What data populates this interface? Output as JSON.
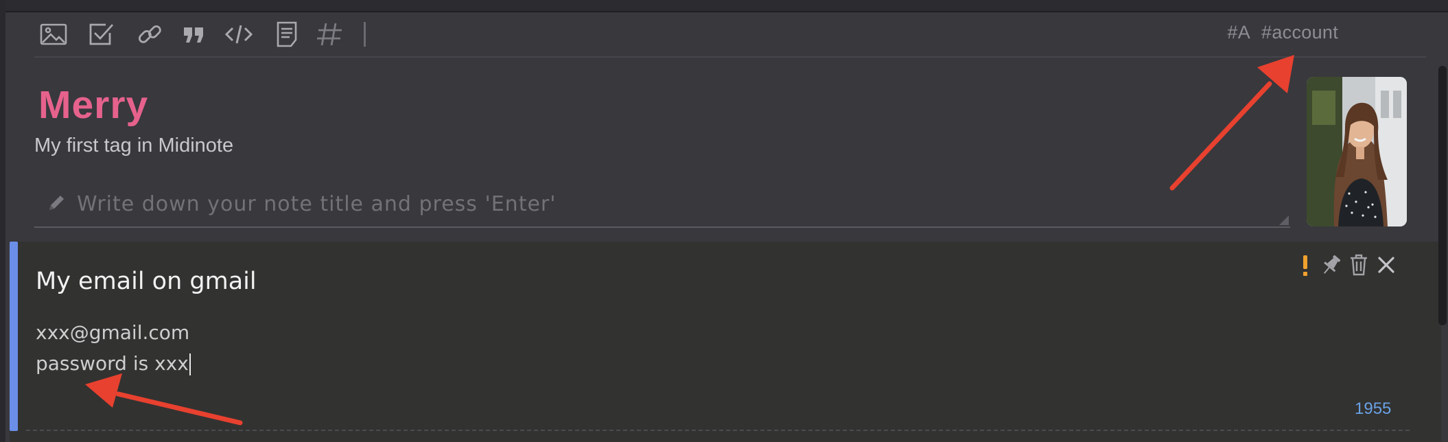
{
  "toolbar": {
    "icons": [
      "image-icon",
      "checkbox-icon",
      "link-icon",
      "quote-icon",
      "code-icon",
      "note-icon",
      "hashtag-icon"
    ],
    "tags": [
      "#A",
      "#account"
    ]
  },
  "tag": {
    "title": "Merry",
    "description": "My first tag in Midinote",
    "title_color": "#e6628d"
  },
  "note_input": {
    "placeholder": "Write down your note title and press 'Enter'",
    "value": ""
  },
  "note_card": {
    "title": "My email on gmail",
    "lines": [
      "xxx@gmail.com",
      "password is xxx"
    ],
    "count": "1955",
    "accent_color": "#6b8fe8",
    "actions": [
      "important-icon",
      "pin-icon",
      "trash-icon",
      "close-icon"
    ]
  },
  "colors": {
    "background": "#38383d",
    "card": "#323231",
    "annotation_arrow": "#e8412f"
  }
}
